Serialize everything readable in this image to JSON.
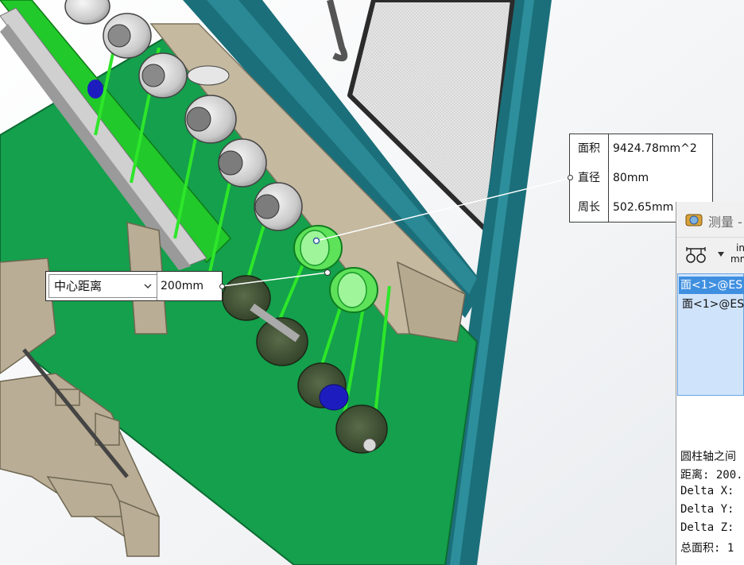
{
  "face_callout": {
    "rows": [
      {
        "label": "面积",
        "value": "9424.78mm^2"
      },
      {
        "label": "直径",
        "value": "80mm"
      },
      {
        "label": "周长",
        "value": "502.65mm"
      }
    ]
  },
  "distance_callout": {
    "mode": "中心距离",
    "value": "200mm"
  },
  "measure_panel": {
    "title": "测量 -",
    "units_label_top": "in",
    "units_label_bottom": "mm",
    "selections": [
      "面<1>@ES",
      "面<1>@ES"
    ],
    "results": [
      "圆柱轴之间",
      "距离: 200.",
      "Delta X:",
      "Delta Y:",
      "Delta Z:",
      "总面积: 1"
    ]
  },
  "colors": {
    "frame_teal": "#1b6f7a",
    "panel_green": "#14a04c",
    "belt_green": "#22d61e",
    "selection_blue": "#3f8fe0",
    "steel_tan": "#b9ad95"
  }
}
